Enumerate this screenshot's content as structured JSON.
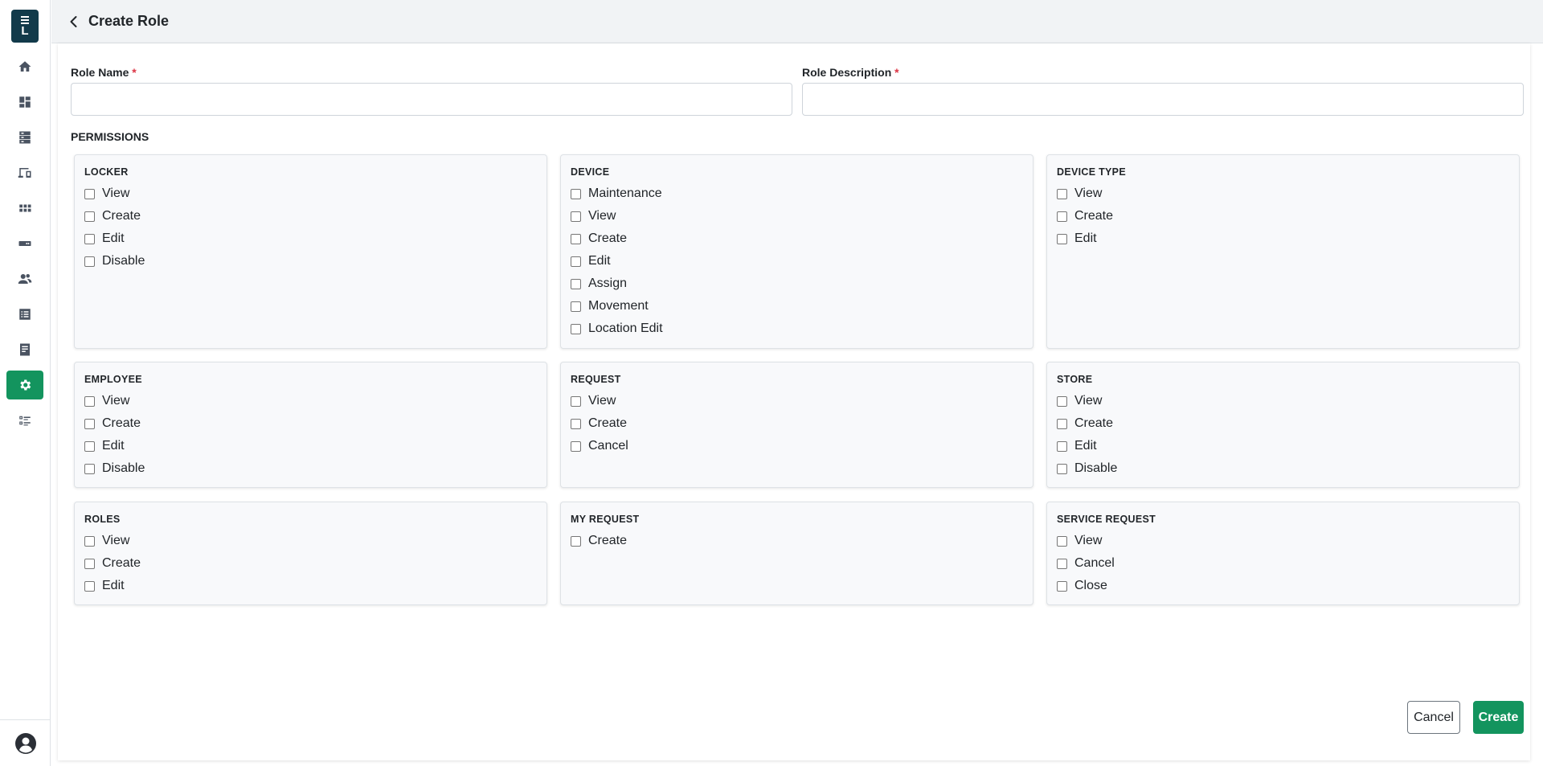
{
  "app": {
    "logo_letter": "L",
    "brand_color": "#123a4a",
    "accent_color": "#13945e"
  },
  "sidebar": {
    "items": [
      {
        "icon": "home-icon",
        "active": false
      },
      {
        "icon": "dashboard-icon",
        "active": false
      },
      {
        "icon": "locker-icon",
        "active": false
      },
      {
        "icon": "devices-icon",
        "active": false
      },
      {
        "icon": "apps-grid-icon",
        "active": false
      },
      {
        "icon": "device-type-icon",
        "active": false
      },
      {
        "icon": "users-icon",
        "active": false
      },
      {
        "icon": "list-icon",
        "active": false
      },
      {
        "icon": "document-icon",
        "active": false
      },
      {
        "icon": "settings-icon",
        "active": true
      },
      {
        "icon": "checklist-icon",
        "active": false
      }
    ],
    "profile_icon": "user-circle-icon"
  },
  "header": {
    "back_icon": "chevron-left-icon",
    "title": "Create Role"
  },
  "form": {
    "role_name_label": "Role Name",
    "role_name_value": "",
    "role_description_label": "Role Description",
    "role_description_value": "",
    "required_marker": "*",
    "permissions_heading": "PERMISSIONS"
  },
  "permissions": [
    {
      "title": "LOCKER",
      "options": [
        "View",
        "Create",
        "Edit",
        "Disable"
      ]
    },
    {
      "title": "DEVICE",
      "options": [
        "Maintenance",
        "View",
        "Create",
        "Edit",
        "Assign",
        "Movement",
        "Location Edit"
      ]
    },
    {
      "title": "DEVICE TYPE",
      "options": [
        "View",
        "Create",
        "Edit"
      ]
    },
    {
      "title": "EMPLOYEE",
      "options": [
        "View",
        "Create",
        "Edit",
        "Disable"
      ]
    },
    {
      "title": "REQUEST",
      "options": [
        "View",
        "Create",
        "Cancel"
      ]
    },
    {
      "title": "STORE",
      "options": [
        "View",
        "Create",
        "Edit",
        "Disable"
      ]
    },
    {
      "title": "ROLES",
      "options": [
        "View",
        "Create",
        "Edit"
      ]
    },
    {
      "title": "MY REQUEST",
      "options": [
        "Create"
      ]
    },
    {
      "title": "SERVICE REQUEST",
      "options": [
        "View",
        "Cancel",
        "Close"
      ]
    }
  ],
  "actions": {
    "cancel_label": "Cancel",
    "create_label": "Create"
  }
}
